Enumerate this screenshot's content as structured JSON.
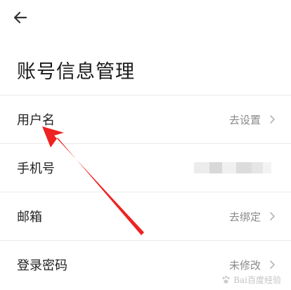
{
  "header": {
    "back_icon": "arrow-left-icon",
    "title": "账号信息管理"
  },
  "rows": [
    {
      "label": "用户名",
      "value": "去设置",
      "chevron": true
    },
    {
      "label": "手机号",
      "value": "",
      "redacted": true,
      "chevron": false
    },
    {
      "label": "邮箱",
      "value": "去绑定",
      "chevron": true
    },
    {
      "label": "登录密码",
      "value": "未修改",
      "chevron": true
    }
  ],
  "annotation": {
    "arrow_color": "#ee2222"
  },
  "watermark": {
    "text": "Bai百度经验"
  }
}
